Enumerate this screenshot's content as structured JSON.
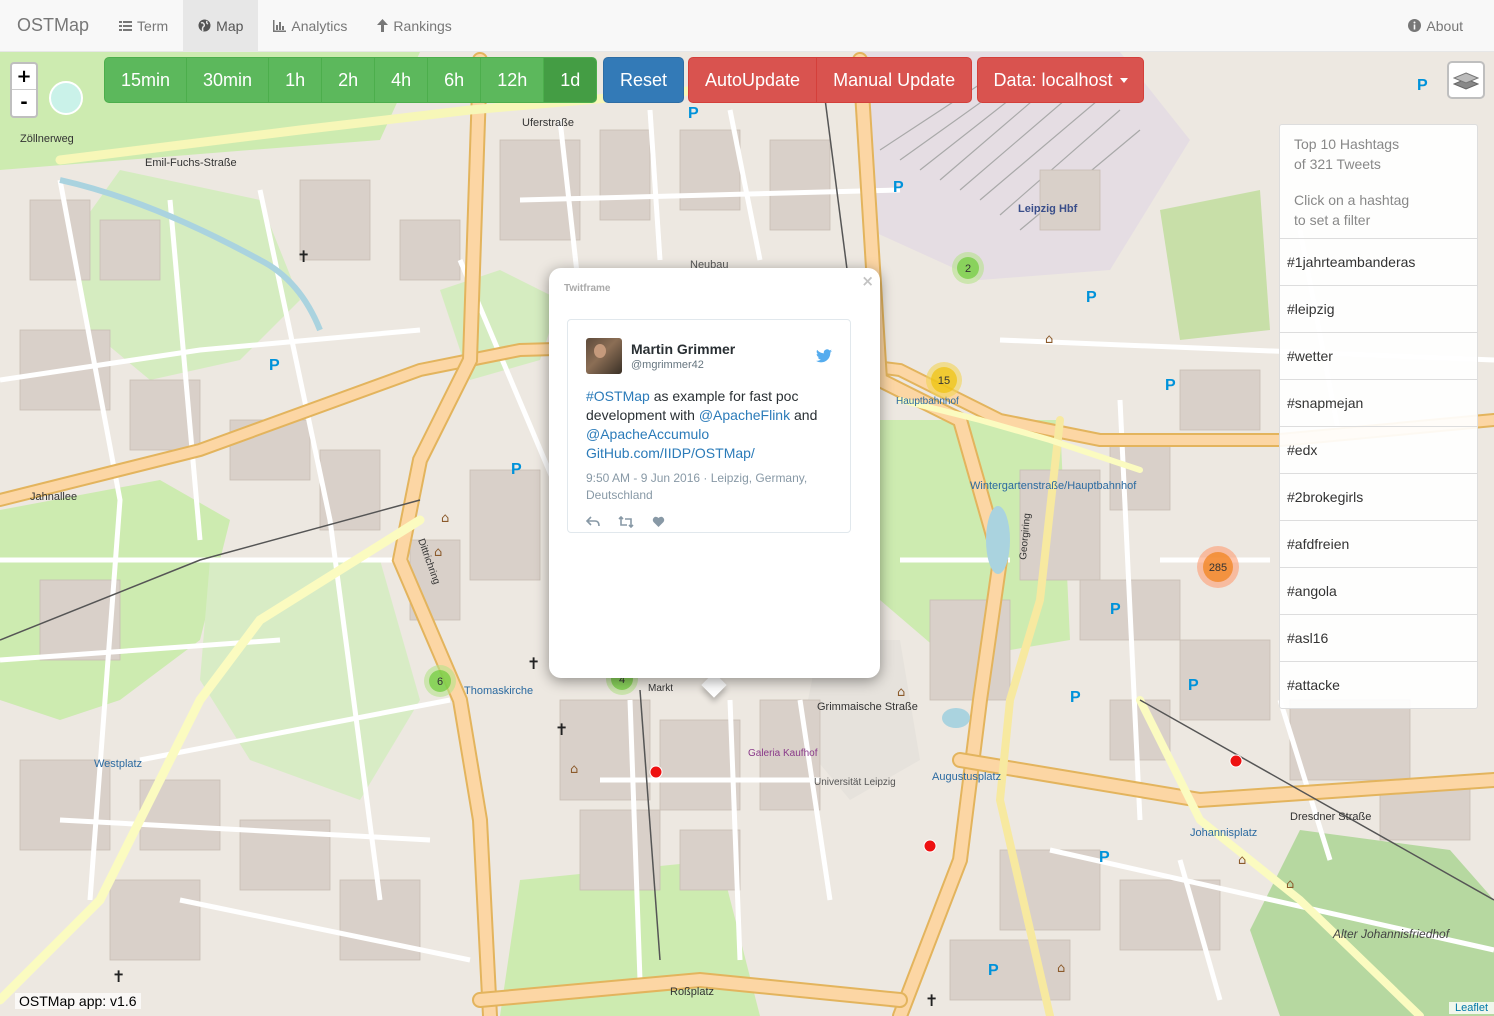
{
  "navbar": {
    "brand": "OSTMap",
    "items": [
      {
        "label": "Term",
        "icon": "list-icon"
      },
      {
        "label": "Map",
        "icon": "globe-icon"
      },
      {
        "label": "Analytics",
        "icon": "bar-chart-icon"
      },
      {
        "label": "Rankings",
        "icon": "arrow-up-icon"
      }
    ],
    "active": "Map",
    "about": "About"
  },
  "zoom": {
    "in": "+",
    "out": "-"
  },
  "time_filters": [
    "15min",
    "30min",
    "1h",
    "2h",
    "4h",
    "6h",
    "12h",
    "1d"
  ],
  "time_selected": "1d",
  "controls": {
    "reset": "Reset",
    "autoupdate": "AutoUpdate",
    "manual": "Manual Update",
    "data_source": "Data: localhost"
  },
  "hashtags": {
    "summary_line1": "Top 10 Hashtags",
    "summary_line2": "of 321 Tweets",
    "hint_line1": "Click on a hashtag",
    "hint_line2": "to set a filter",
    "items": [
      "#1jahrteambanderas",
      "#leipzig",
      "#wetter",
      "#snapmejan",
      "#edx",
      "#2brokegirls",
      "#afdfreien",
      "#angola",
      "#asl16",
      "#attacke"
    ]
  },
  "popup": {
    "title": "Twitframe",
    "close": "×",
    "tweet": {
      "name": "Martin Grimmer",
      "handle": "@mgrimmer42",
      "text_parts": [
        "#OSTMap",
        " as example for fast poc development with ",
        "@ApacheFlink",
        " and ",
        "@ApacheAccumulo",
        "GitHub.com/IIDP/OSTMap/"
      ],
      "meta_time": "9:50 AM - 9 Jun 2016 · Leipzig, Germany,",
      "meta_place": "Deutschland"
    }
  },
  "clusters": [
    {
      "count": "2",
      "color": "#8ec35a"
    },
    {
      "count": "15",
      "color": "#e8d64a"
    },
    {
      "count": "285",
      "color": "#f0a050"
    },
    {
      "count": "6",
      "color": "#8ec35a"
    },
    {
      "count": "4",
      "color": "#8ec35a"
    }
  ],
  "map_labels": {
    "leipzig_hbf": "Leipzig Hbf",
    "uferstrasse": "Uferstraße",
    "zoellnerweg": "Zöllnerweg",
    "emil_fuchs": "Emil-Fuchs-Straße",
    "jahnallee": "Jahnallee",
    "thomaskirche": "Thomaskirche",
    "augustusplatz": "Augustusplatz",
    "westplatz": "Westplatz",
    "rossplatz": "Roßplatz",
    "johannisplatz": "Johannisplatz",
    "alter_johannisfriedhof": "Alter Johannisfriedhof",
    "dresdner": "Dresdner Straße",
    "wintergarten": "Wintergartenstraße/Hauptbahnhof",
    "grimmaische": "Grimmaische Straße",
    "markt": "Markt",
    "universitaet": "Universität Leipzig",
    "galeria": "Galeria Kaufhof",
    "neubau": "Neubau",
    "hauptbahnhof": "Hauptbahnhof",
    "dittrichring": "Dittrichring",
    "georgiring": "Georgiring"
  },
  "version": "OSTMap app: v1.6",
  "attribution": "Leaflet"
}
